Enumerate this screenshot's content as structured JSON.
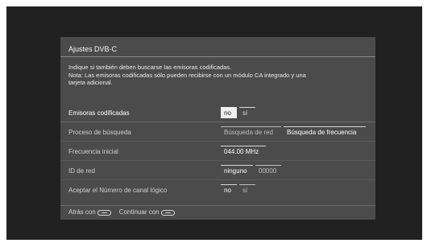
{
  "dialog": {
    "title": "Ajustes DVB-C",
    "info_line1": "Indique si también deben buscarse las emisoras codificadas.",
    "info_line2": "Nota: Las emisoras codificadas sólo pueden recibirse con un módulo CA integrado y una",
    "info_line3": "tarjeta adicional."
  },
  "rows": [
    {
      "label": "Emisoras codificadas",
      "options": [
        "no",
        "sí"
      ],
      "selected": "no"
    },
    {
      "label": "Proceso de búsqueda",
      "options": [
        "Búsqueda de red",
        "Búsqueda de frecuencia"
      ],
      "selected": "Búsqueda de frecuencia"
    },
    {
      "label": "Frecuencia inicial",
      "value": "044.00 MHz"
    },
    {
      "label": "ID de red",
      "options": [
        "ninguno",
        "00000"
      ],
      "selected": "ninguno"
    },
    {
      "label": "Aceptar el Número de canal lógico",
      "options": [
        "no",
        "sí"
      ],
      "selected": "no"
    }
  ],
  "footer": {
    "back_label": "Atrás con",
    "back_icon": "back-key-icon",
    "continue_label": "Continuar con",
    "continue_icon": "ok-key-icon"
  },
  "colors": {
    "screen_bg": "#212121",
    "dialog_bg": "#4b4b4b",
    "highlight": "#f0f0f0"
  }
}
